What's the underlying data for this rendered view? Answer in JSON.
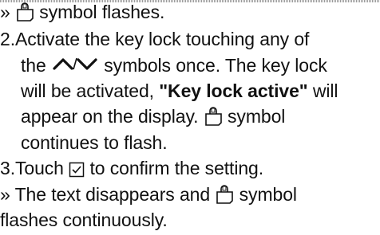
{
  "lines": {
    "l1": {
      "prefix": "»",
      "text": "symbol flashes."
    },
    "l2": {
      "num": "2.",
      "text": "Activate the key lock touching any of"
    },
    "l3": {
      "pre": "the",
      "post": "symbols once. The key lock"
    },
    "l4": {
      "pre": "will be activated,",
      "bold": "\"Key lock active\"",
      "post": "will"
    },
    "l5": {
      "pre": "appear on the display.",
      "post": "symbol"
    },
    "l6": {
      "text": "continues to flash."
    },
    "l7": {
      "num": "3.",
      "pre": "Touch",
      "post": "to confirm the setting."
    },
    "l8": {
      "prefix": "»",
      "pre": "The text disappears and",
      "post": "symbol"
    },
    "l9": {
      "text": "flashes continuously."
    }
  },
  "icons": {
    "key_lock": "key-lock-icon",
    "up_down_arrows": "up-down-arrows-icon",
    "confirm": "checkbox-confirm-icon"
  }
}
